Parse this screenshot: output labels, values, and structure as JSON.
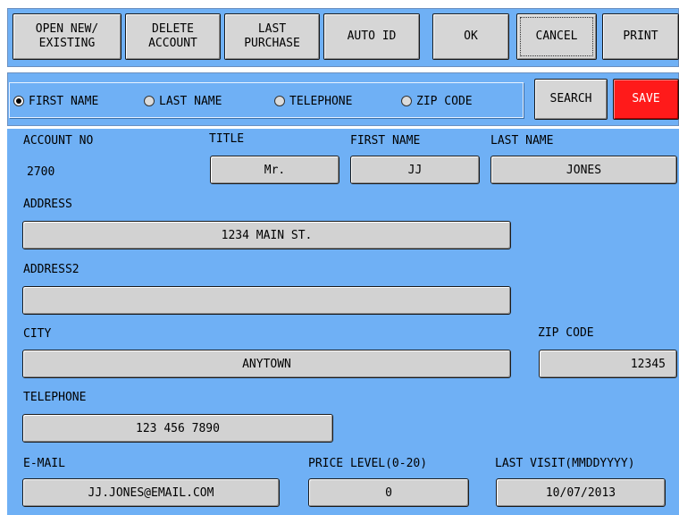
{
  "toolbar": {
    "open_new_existing": "OPEN NEW/\nEXISTING",
    "delete_account": "DELETE\nACCOUNT",
    "last_purchase": "LAST\nPURCHASE",
    "auto_id": "AUTO ID",
    "ok": "OK",
    "cancel": "CANCEL",
    "print": "PRINT"
  },
  "search": {
    "options": [
      {
        "label": "FIRST NAME",
        "checked": true
      },
      {
        "label": "LAST NAME",
        "checked": false
      },
      {
        "label": "TELEPHONE",
        "checked": false
      },
      {
        "label": "ZIP CODE",
        "checked": false
      }
    ],
    "search_label": "SEARCH",
    "save_label": "SAVE"
  },
  "form": {
    "account_no_label": "ACCOUNT NO",
    "account_no": "2700",
    "title_label": "TITLE",
    "title": "Mr.",
    "first_name_label": "FIRST NAME",
    "first_name": "JJ",
    "last_name_label": "LAST NAME",
    "last_name": "JONES",
    "address_label": "ADDRESS",
    "address": "1234 MAIN ST.",
    "address2_label": "ADDRESS2",
    "address2": "",
    "city_label": "CITY",
    "city": "ANYTOWN",
    "zip_code_label": "ZIP CODE",
    "zip_code": "12345",
    "telephone_label": "TELEPHONE",
    "telephone": "123 456 7890",
    "email_label": "E-MAIL",
    "email": "JJ.JONES@EMAIL.COM",
    "price_level_label": "PRICE LEVEL(0-20)",
    "price_level": "0",
    "last_visit_label": "LAST VISIT(MMDDYYYY)",
    "last_visit": "10/07/2013"
  },
  "colors": {
    "panel": "#6fb0f5",
    "button": "#d6d6d6",
    "save": "#ff1a1a"
  }
}
